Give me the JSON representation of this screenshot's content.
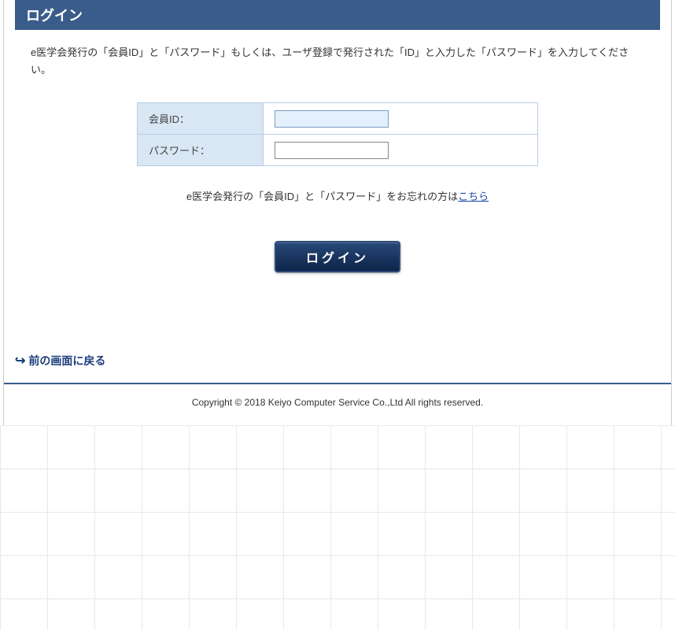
{
  "header": {
    "title": "ログイン"
  },
  "instruction": {
    "text": "e医学会発行の「会員ID」と「パスワード」もしくは、ユーザ登録で発行された「ID」と入力した「パスワード」を入力してください。"
  },
  "form": {
    "member_id_label": "会員ID：",
    "member_id_value": "",
    "password_label": "パスワード：",
    "password_value": ""
  },
  "forgot": {
    "prefix": "e医学会発行の「会員ID」と「パスワード」をお忘れの方は",
    "link_text": "こちら"
  },
  "login_button": {
    "label": "ログイン"
  },
  "back_link": {
    "label": "前の画面に戻る"
  },
  "footer": {
    "copyright": "Copyright © 2018 Keiyo Computer Service Co.,Ltd All rights reserved."
  }
}
